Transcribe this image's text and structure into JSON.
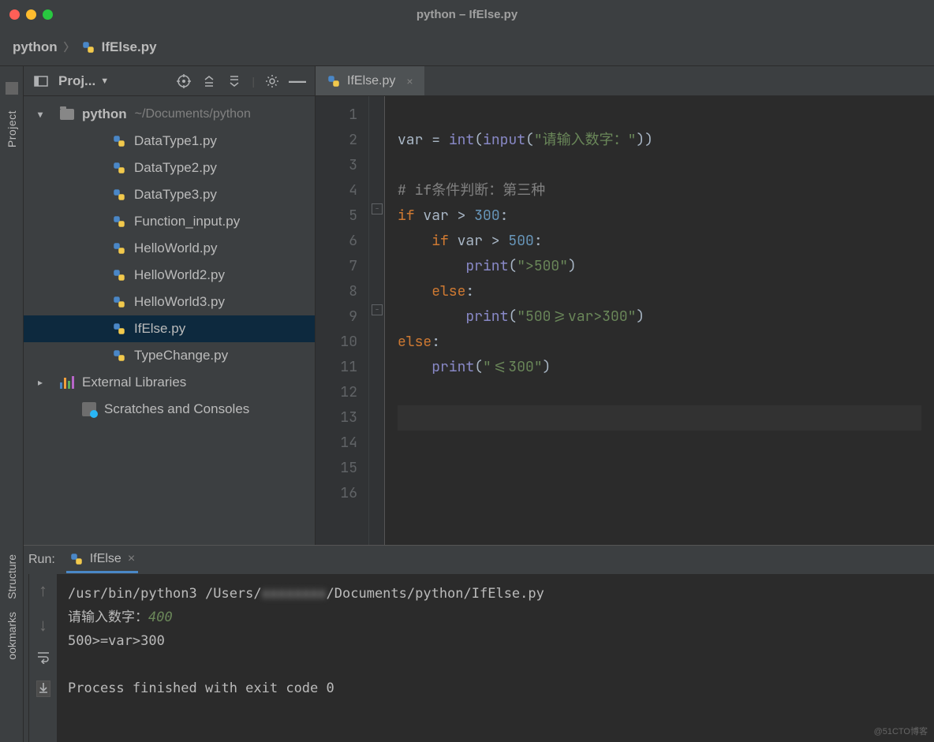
{
  "window": {
    "title": "python – IfElse.py"
  },
  "breadcrumb": {
    "items": [
      "python",
      "IfElse.py"
    ]
  },
  "sidebar": {
    "project_label": "Project",
    "structure_label": "Structure",
    "bookmarks_label": "ookmarks"
  },
  "project_panel": {
    "header_label": "Proj...",
    "root_name": "python",
    "root_path": "~/Documents/python",
    "files": [
      "DataType1.py",
      "DataType2.py",
      "DataType3.py",
      "Function_input.py",
      "HelloWorld.py",
      "HelloWorld2.py",
      "HelloWorld3.py",
      "IfElse.py",
      "TypeChange.py"
    ],
    "selected_index": 7,
    "external_libraries": "External Libraries",
    "scratches": "Scratches and Consoles"
  },
  "editor": {
    "tab_name": "IfElse.py",
    "lines": [
      {
        "n": 1,
        "tokens": []
      },
      {
        "n": 2,
        "tokens": [
          {
            "t": "var ",
            "c": "plain"
          },
          {
            "t": "=",
            "c": "plain"
          },
          {
            "t": " ",
            "c": "plain"
          },
          {
            "t": "int",
            "c": "builtin"
          },
          {
            "t": "(",
            "c": "plain"
          },
          {
            "t": "input",
            "c": "builtin"
          },
          {
            "t": "(",
            "c": "plain"
          },
          {
            "t": "\"请输入数字：\"",
            "c": "str"
          },
          {
            "t": "))",
            "c": "plain"
          }
        ]
      },
      {
        "n": 3,
        "tokens": []
      },
      {
        "n": 4,
        "tokens": [
          {
            "t": "# if条件判断：第三种",
            "c": "cmt"
          }
        ]
      },
      {
        "n": 5,
        "tokens": [
          {
            "t": "if ",
            "c": "kw"
          },
          {
            "t": "var > ",
            "c": "plain"
          },
          {
            "t": "300",
            "c": "num"
          },
          {
            "t": ":",
            "c": "plain"
          }
        ]
      },
      {
        "n": 6,
        "tokens": [
          {
            "t": "    ",
            "c": "plain"
          },
          {
            "t": "if ",
            "c": "kw"
          },
          {
            "t": "var > ",
            "c": "plain"
          },
          {
            "t": "500",
            "c": "num"
          },
          {
            "t": ":",
            "c": "plain"
          }
        ]
      },
      {
        "n": 7,
        "tokens": [
          {
            "t": "        ",
            "c": "plain"
          },
          {
            "t": "print",
            "c": "builtin"
          },
          {
            "t": "(",
            "c": "plain"
          },
          {
            "t": "\">500\"",
            "c": "str"
          },
          {
            "t": ")",
            "c": "plain"
          }
        ]
      },
      {
        "n": 8,
        "tokens": [
          {
            "t": "    ",
            "c": "plain"
          },
          {
            "t": "else",
            "c": "kw"
          },
          {
            "t": ":",
            "c": "plain"
          }
        ]
      },
      {
        "n": 9,
        "tokens": [
          {
            "t": "        ",
            "c": "plain"
          },
          {
            "t": "print",
            "c": "builtin"
          },
          {
            "t": "(",
            "c": "plain"
          },
          {
            "t": "\"500>=var>300\"",
            "c": "str"
          },
          {
            "t": ")",
            "c": "plain"
          }
        ]
      },
      {
        "n": 10,
        "tokens": [
          {
            "t": "else",
            "c": "kw"
          },
          {
            "t": ":",
            "c": "plain"
          }
        ]
      },
      {
        "n": 11,
        "tokens": [
          {
            "t": "    ",
            "c": "plain"
          },
          {
            "t": "print",
            "c": "builtin"
          },
          {
            "t": "(",
            "c": "plain"
          },
          {
            "t": "\"<=300\"",
            "c": "str"
          },
          {
            "t": ")",
            "c": "plain"
          }
        ]
      },
      {
        "n": 12,
        "tokens": []
      },
      {
        "n": 13,
        "tokens": []
      },
      {
        "n": 14,
        "tokens": []
      },
      {
        "n": 15,
        "tokens": []
      },
      {
        "n": 16,
        "tokens": []
      }
    ],
    "selected_line": 13
  },
  "run": {
    "label": "Run:",
    "tab": "IfElse",
    "output": {
      "cmd_pre": "/usr/bin/python3 /Users/",
      "cmd_blur": "xxxxxxxx",
      "cmd_post": "/Documents/python/IfElse.py",
      "prompt": "请输入数字：",
      "input_value": "400",
      "result": "500>=var>300",
      "exit": "Process finished with exit code 0"
    }
  },
  "watermark": "@51CTO博客"
}
